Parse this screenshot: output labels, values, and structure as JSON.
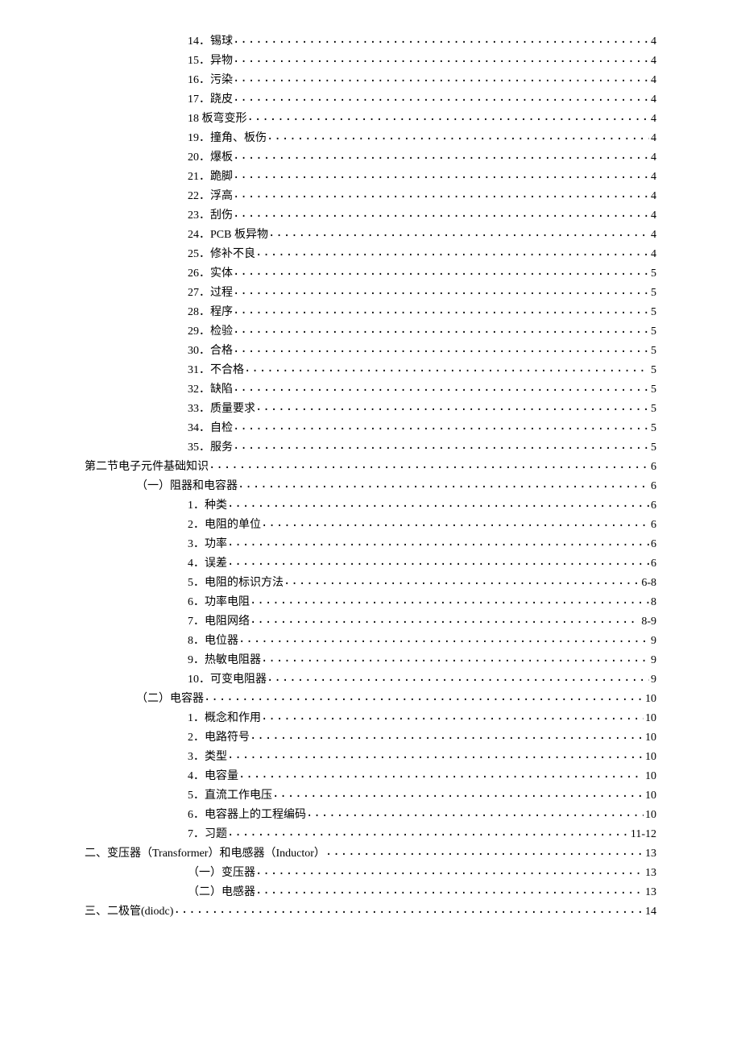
{
  "toc": [
    {
      "indent": 2,
      "label": "14．锡球",
      "page": "4"
    },
    {
      "indent": 2,
      "label": "15．异物",
      "page": "4"
    },
    {
      "indent": 2,
      "label": "16．污染",
      "page": "4"
    },
    {
      "indent": 2,
      "label": "17．跷皮",
      "page": "4"
    },
    {
      "indent": 2,
      "label": "18 板弯变形",
      "page": "4"
    },
    {
      "indent": 2,
      "label": "19．撞角、板伤",
      "page": "4"
    },
    {
      "indent": 2,
      "label": "20．爆板",
      "page": "4"
    },
    {
      "indent": 2,
      "label": "21．跪脚",
      "page": "4"
    },
    {
      "indent": 2,
      "label": "22．浮高",
      "page": "4"
    },
    {
      "indent": 2,
      "label": "23．刮伤",
      "page": "4"
    },
    {
      "indent": 2,
      "label": "24．PCB 板异物",
      "page": "4"
    },
    {
      "indent": 2,
      "label": "25．修补不良",
      "page": "4"
    },
    {
      "indent": 2,
      "label": "26．实体",
      "page": "5"
    },
    {
      "indent": 2,
      "label": "27．过程",
      "page": "5"
    },
    {
      "indent": 2,
      "label": "28．程序",
      "page": "5"
    },
    {
      "indent": 2,
      "label": "29．检验",
      "page": "5"
    },
    {
      "indent": 2,
      "label": "30．合格",
      "page": "5"
    },
    {
      "indent": 2,
      "label": "31．不合格",
      "page": "5"
    },
    {
      "indent": 2,
      "label": "32．缺陷",
      "page": "5"
    },
    {
      "indent": 2,
      "label": "33．质量要求",
      "page": "5"
    },
    {
      "indent": 2,
      "label": "34．自检",
      "page": "5"
    },
    {
      "indent": 2,
      "label": "35．服务",
      "page": "5"
    },
    {
      "indent": 0,
      "label": "第二节电子元件基础知识",
      "page": " 6"
    },
    {
      "indent": 1,
      "label": "（一）阻器和电容器",
      "page": "6"
    },
    {
      "indent": 2,
      "label": "1．种类",
      "page": "6"
    },
    {
      "indent": 2,
      "label": "2．电阻的单位",
      "page": "6"
    },
    {
      "indent": 2,
      "label": "3．功率",
      "page": "6"
    },
    {
      "indent": 2,
      "label": "4．误差",
      "page": "6"
    },
    {
      "indent": 2,
      "label": "5．电阻的标识方法",
      "page": "6-8"
    },
    {
      "indent": 2,
      "label": "6．功率电阻",
      "page": "8"
    },
    {
      "indent": 2,
      "label": "7．电阻网络",
      "page": "8-9"
    },
    {
      "indent": 2,
      "label": "8．电位器",
      "page": "9"
    },
    {
      "indent": 2,
      "label": "9．热敏电阻器",
      "page": "9"
    },
    {
      "indent": 2,
      "label": "10．可变电阻器",
      "page": "9"
    },
    {
      "indent": 1,
      "label": "（二）电容器",
      "page": "10"
    },
    {
      "indent": 2,
      "label": "1．概念和作用",
      "page": "10"
    },
    {
      "indent": 2,
      "label": "2．电路符号",
      "page": "10"
    },
    {
      "indent": 2,
      "label": "3．类型",
      "page": "10"
    },
    {
      "indent": 2,
      "label": "4．电容量",
      "page": "10"
    },
    {
      "indent": 2,
      "label": "5．直流工作电压",
      "page": "10"
    },
    {
      "indent": 2,
      "label": "6．电容器上的工程编码",
      "page": "10"
    },
    {
      "indent": 2,
      "label": "7．习题",
      "page": "11-12"
    },
    {
      "indent": 0,
      "label": "二、变压器（Transformer）和电感器（Inductor）",
      "page": "13"
    },
    {
      "indent": 2,
      "label": "（一）变压器",
      "page": "13"
    },
    {
      "indent": 2,
      "label": "（二）电感器",
      "page": "13"
    },
    {
      "indent": 0,
      "label": "三、二极管(diodc)",
      "page": "14"
    }
  ]
}
